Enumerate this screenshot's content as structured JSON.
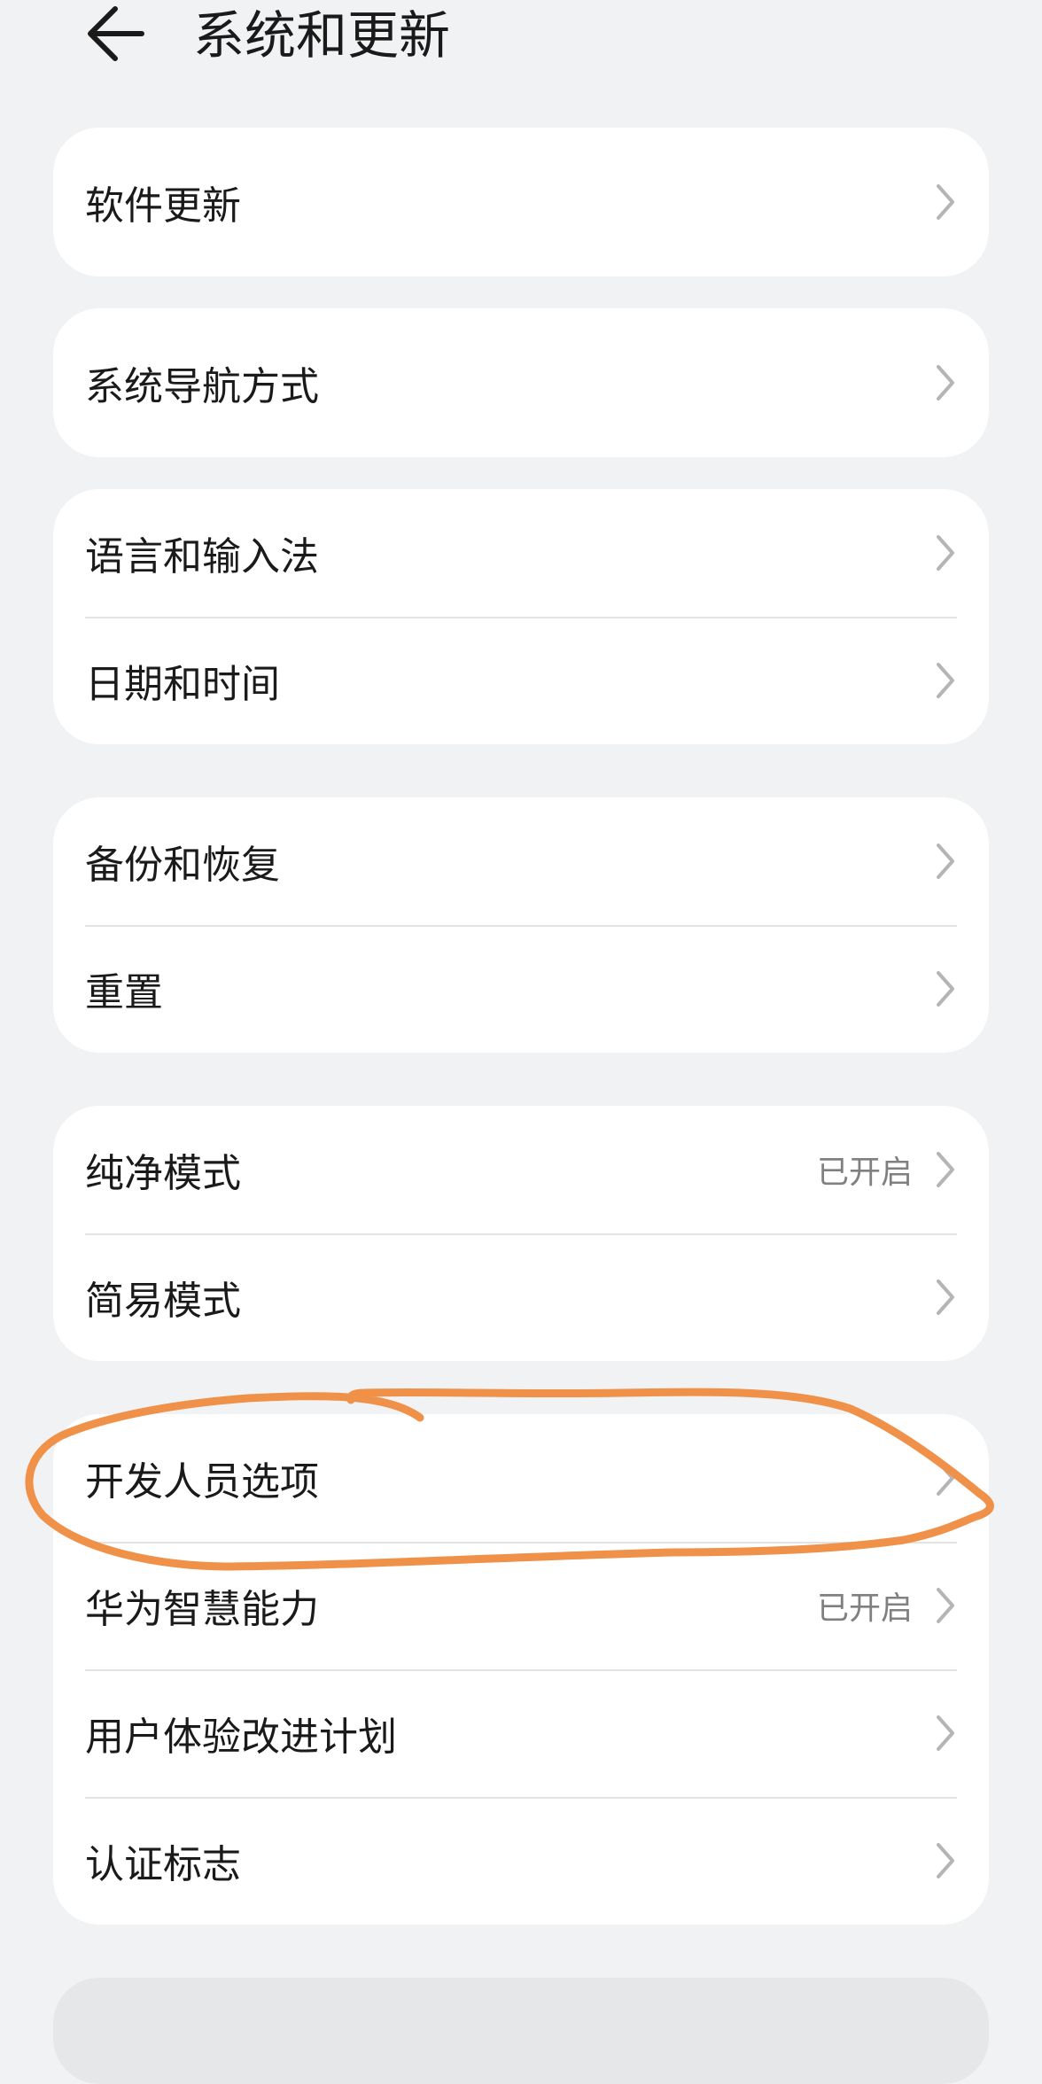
{
  "header": {
    "title": "系统和更新",
    "back_icon": "arrow-left-icon"
  },
  "groups": [
    {
      "items": [
        {
          "label": "软件更新",
          "status": ""
        }
      ]
    },
    {
      "items": [
        {
          "label": "系统导航方式",
          "status": ""
        }
      ]
    },
    {
      "items": [
        {
          "label": "语言和输入法",
          "status": ""
        },
        {
          "label": "日期和时间",
          "status": ""
        }
      ]
    },
    {
      "items": [
        {
          "label": "备份和恢复",
          "status": ""
        },
        {
          "label": "重置",
          "status": ""
        }
      ]
    },
    {
      "items": [
        {
          "label": "纯净模式",
          "status": "已开启"
        },
        {
          "label": "简易模式",
          "status": ""
        }
      ]
    },
    {
      "items": [
        {
          "label": "开发人员选项",
          "status": ""
        },
        {
          "label": "华为智慧能力",
          "status": "已开启"
        },
        {
          "label": "用户体验改进计划",
          "status": ""
        },
        {
          "label": "认证标志",
          "status": ""
        }
      ]
    }
  ],
  "annotation": {
    "color": "#f0914a",
    "target": "开发人员选项"
  },
  "colors": {
    "background": "#f1f2f4",
    "card": "#ffffff",
    "divider": "#e3e3e3",
    "status_text": "#808080",
    "chevron": "#b5b5b5"
  }
}
